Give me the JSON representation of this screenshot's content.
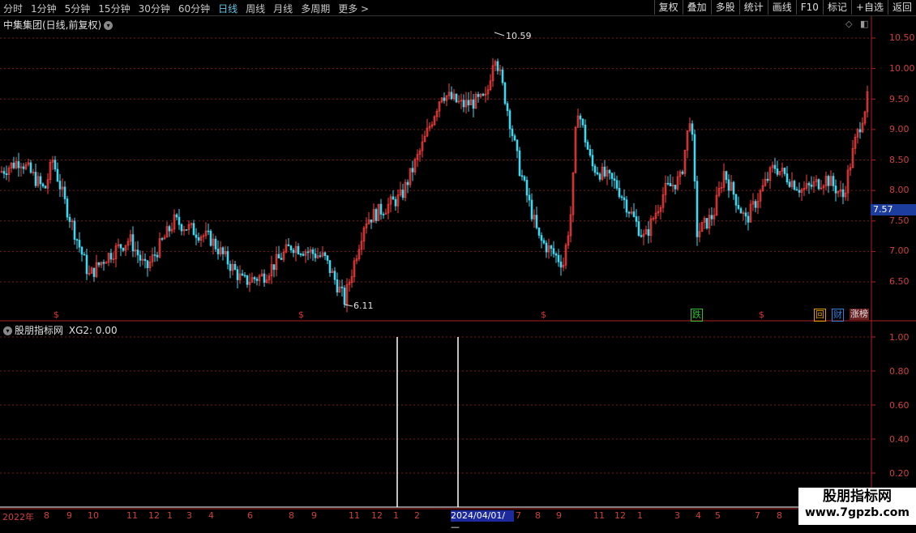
{
  "toolbar": {
    "tabs": [
      {
        "label": "分时",
        "active": false
      },
      {
        "label": "1分钟",
        "active": false
      },
      {
        "label": "5分钟",
        "active": false
      },
      {
        "label": "15分钟",
        "active": false
      },
      {
        "label": "30分钟",
        "active": false
      },
      {
        "label": "60分钟",
        "active": false
      },
      {
        "label": "日线",
        "active": true
      },
      {
        "label": "周线",
        "active": false
      },
      {
        "label": "月线",
        "active": false
      },
      {
        "label": "多周期",
        "active": false
      },
      {
        "label": "更多 >",
        "active": false
      }
    ],
    "right_buttons": [
      "复权",
      "叠加",
      "多股",
      "统计",
      "画线",
      "F10",
      "标记",
      "+自选",
      "返回"
    ]
  },
  "main_chart": {
    "title": "中集集团(日线,前复权)",
    "high_label": "10.59",
    "low_label": "6.11",
    "current_price": "7.57",
    "y_axis_labels": [
      "10.50",
      "10.00",
      "9.50",
      "9.00",
      "8.50",
      "8.00",
      "7.50",
      "7.00",
      "6.50"
    ],
    "event_markers": [
      "$",
      "$",
      "$",
      "$"
    ],
    "badges": [
      {
        "label": "跌",
        "color": "#30c030"
      },
      {
        "label": "回",
        "color": "#e0a000"
      },
      {
        "label": "财",
        "color": "#3080e0"
      },
      {
        "label": "涨榜",
        "color": "#e0e0e0"
      }
    ]
  },
  "indicator": {
    "title": "股朋指标网",
    "value_text": "XG2: 0.00",
    "y_axis_labels": [
      "1.00",
      "0.80",
      "0.60",
      "0.40",
      "0.20"
    ]
  },
  "date_axis": {
    "labels": [
      "2022年",
      "8",
      "9",
      "10",
      "11",
      "12",
      "1",
      "3",
      "4",
      "6",
      "8",
      "9",
      "11",
      "12",
      "1",
      "2",
      "7",
      "8",
      "9",
      "11",
      "12",
      "1",
      "3",
      "4",
      "5",
      "7",
      "8"
    ],
    "highlight": "2024/04/01/—"
  },
  "watermark": {
    "line1": "股朋指标网",
    "line2": "www.7gpzb.com"
  },
  "colors": {
    "up": "#ff4040",
    "down": "#40d8f0",
    "axis": "#b02020",
    "grid": "#7a1a1a",
    "active_tab": "#5fc8e8"
  }
}
